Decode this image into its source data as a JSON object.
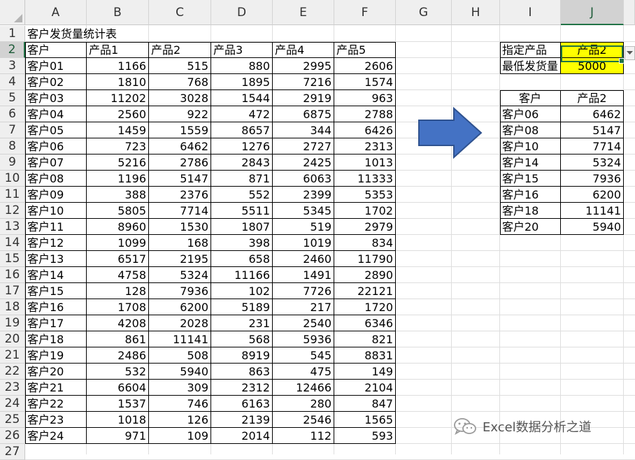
{
  "columns": [
    "A",
    "B",
    "C",
    "D",
    "E",
    "F",
    "G",
    "H",
    "I",
    "J"
  ],
  "rows": [
    "1",
    "2",
    "3",
    "4",
    "5",
    "6",
    "7",
    "8",
    "9",
    "10",
    "11",
    "12",
    "13",
    "14",
    "15",
    "16",
    "17",
    "18",
    "19",
    "20",
    "21",
    "22",
    "23",
    "24",
    "25",
    "26",
    "27"
  ],
  "selected_column": "J",
  "selected_row": "2",
  "title": "客户发货量统计表",
  "main_table": {
    "headers": [
      "客户",
      "产品1",
      "产品2",
      "产品3",
      "产品4",
      "产品5"
    ],
    "rows": [
      [
        "客户01",
        "1166",
        "515",
        "880",
        "2995",
        "2606"
      ],
      [
        "客户02",
        "1810",
        "768",
        "1895",
        "7216",
        "1574"
      ],
      [
        "客户03",
        "11202",
        "3028",
        "1544",
        "2919",
        "963"
      ],
      [
        "客户04",
        "2560",
        "922",
        "472",
        "6875",
        "2788"
      ],
      [
        "客户05",
        "1459",
        "1559",
        "8657",
        "344",
        "6426"
      ],
      [
        "客户06",
        "723",
        "6462",
        "1276",
        "2727",
        "2313"
      ],
      [
        "客户07",
        "5216",
        "2786",
        "2843",
        "2425",
        "1013"
      ],
      [
        "客户08",
        "1196",
        "5147",
        "871",
        "6063",
        "11333"
      ],
      [
        "客户09",
        "388",
        "2376",
        "552",
        "2399",
        "5353"
      ],
      [
        "客户10",
        "5805",
        "7714",
        "5511",
        "5345",
        "1702"
      ],
      [
        "客户11",
        "8960",
        "1530",
        "1807",
        "519",
        "2979"
      ],
      [
        "客户12",
        "1099",
        "168",
        "398",
        "1019",
        "834"
      ],
      [
        "客户13",
        "6517",
        "2195",
        "658",
        "2460",
        "11790"
      ],
      [
        "客户14",
        "4758",
        "5324",
        "11166",
        "1491",
        "2890"
      ],
      [
        "客户15",
        "128",
        "7936",
        "102",
        "7726",
        "22121"
      ],
      [
        "客户16",
        "1708",
        "6200",
        "5189",
        "217",
        "1720"
      ],
      [
        "客户17",
        "4208",
        "2028",
        "231",
        "2540",
        "6346"
      ],
      [
        "客户18",
        "861",
        "11141",
        "568",
        "5936",
        "821"
      ],
      [
        "客户19",
        "2486",
        "508",
        "8919",
        "545",
        "8831"
      ],
      [
        "客户20",
        "532",
        "5940",
        "863",
        "475",
        "149"
      ],
      [
        "客户21",
        "6604",
        "309",
        "2312",
        "12466",
        "2104"
      ],
      [
        "客户22",
        "1537",
        "746",
        "6163",
        "280",
        "847"
      ],
      [
        "客户23",
        "1018",
        "126",
        "2139",
        "2546",
        "1565"
      ],
      [
        "客户24",
        "971",
        "109",
        "2014",
        "112",
        "593"
      ]
    ]
  },
  "criteria": {
    "product_label": "指定产品",
    "product_value": "产品2",
    "min_label": "最低发货量",
    "min_value": "5000"
  },
  "result_table": {
    "headers": [
      "客户",
      "产品2"
    ],
    "rows": [
      [
        "客户06",
        "6462"
      ],
      [
        "客户08",
        "5147"
      ],
      [
        "客户10",
        "7714"
      ],
      [
        "客户14",
        "5324"
      ],
      [
        "客户15",
        "7936"
      ],
      [
        "客户16",
        "6200"
      ],
      [
        "客户18",
        "11141"
      ],
      [
        "客户20",
        "5940"
      ]
    ]
  },
  "watermark": "Excel数据分析之道",
  "icons": {
    "arrow": "right-arrow-icon",
    "dropdown": "chevron-down-icon",
    "watermark": "wechat-icon"
  },
  "colors": {
    "arrow_fill": "#4472c4",
    "arrow_stroke": "#2f528f",
    "highlight": "#ffff00",
    "selection": "#217346"
  }
}
